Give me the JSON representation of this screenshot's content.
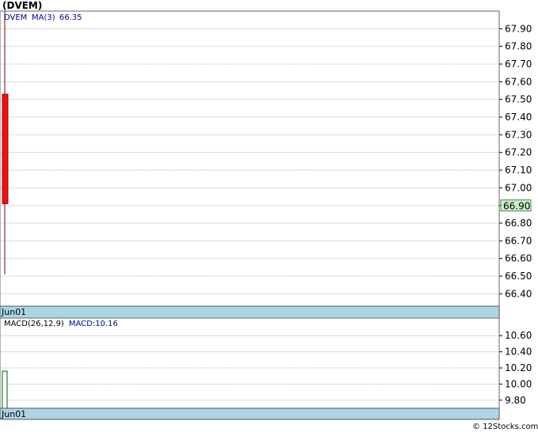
{
  "title": "(DVEM)",
  "watermark": "© 12Stocks.com",
  "colors": {
    "candle_down": "#ee1111",
    "wick": "#800000",
    "date_bar": "#abd6e6",
    "price_box": "#c8f0c8",
    "ma_label": "#0000aa",
    "ticker_label": "#000080",
    "macd_bar": "#006400"
  },
  "price_panel": {
    "ticker_label": "DVEM",
    "ma_label": "MA(3)",
    "ma_value": "66.35",
    "current_price_label": "66.90",
    "date_label": "Jun01",
    "ticks": [
      "67.90",
      "67.80",
      "67.70",
      "67.60",
      "67.50",
      "67.40",
      "67.30",
      "67.20",
      "67.10",
      "67.00",
      "66.90",
      "66.80",
      "66.70",
      "66.60",
      "66.50",
      "66.40"
    ]
  },
  "macd_panel": {
    "label": "MACD(26,12,9)",
    "value_label": "MACD:10.16",
    "date_label": "Jun01",
    "ticks": [
      "10.60",
      "10.40",
      "10.20",
      "10.00",
      "9.80"
    ]
  },
  "chart_data": [
    {
      "type": "candlestick",
      "title": "(DVEM)",
      "x": [
        "Jun01"
      ],
      "series": [
        {
          "name": "DVEM",
          "open": [
            67.53
          ],
          "high": [
            68.0
          ],
          "low": [
            66.51
          ],
          "close": [
            66.91
          ]
        },
        {
          "name": "MA(3)",
          "values": [
            66.35
          ]
        }
      ],
      "ylim": [
        66.33,
        68.0
      ],
      "grid": true
    },
    {
      "type": "bar",
      "x": [
        "Jun01"
      ],
      "series": [
        {
          "name": "MACD",
          "values": [
            10.16
          ]
        }
      ],
      "ylim": [
        9.7,
        10.7
      ],
      "grid": true
    }
  ]
}
